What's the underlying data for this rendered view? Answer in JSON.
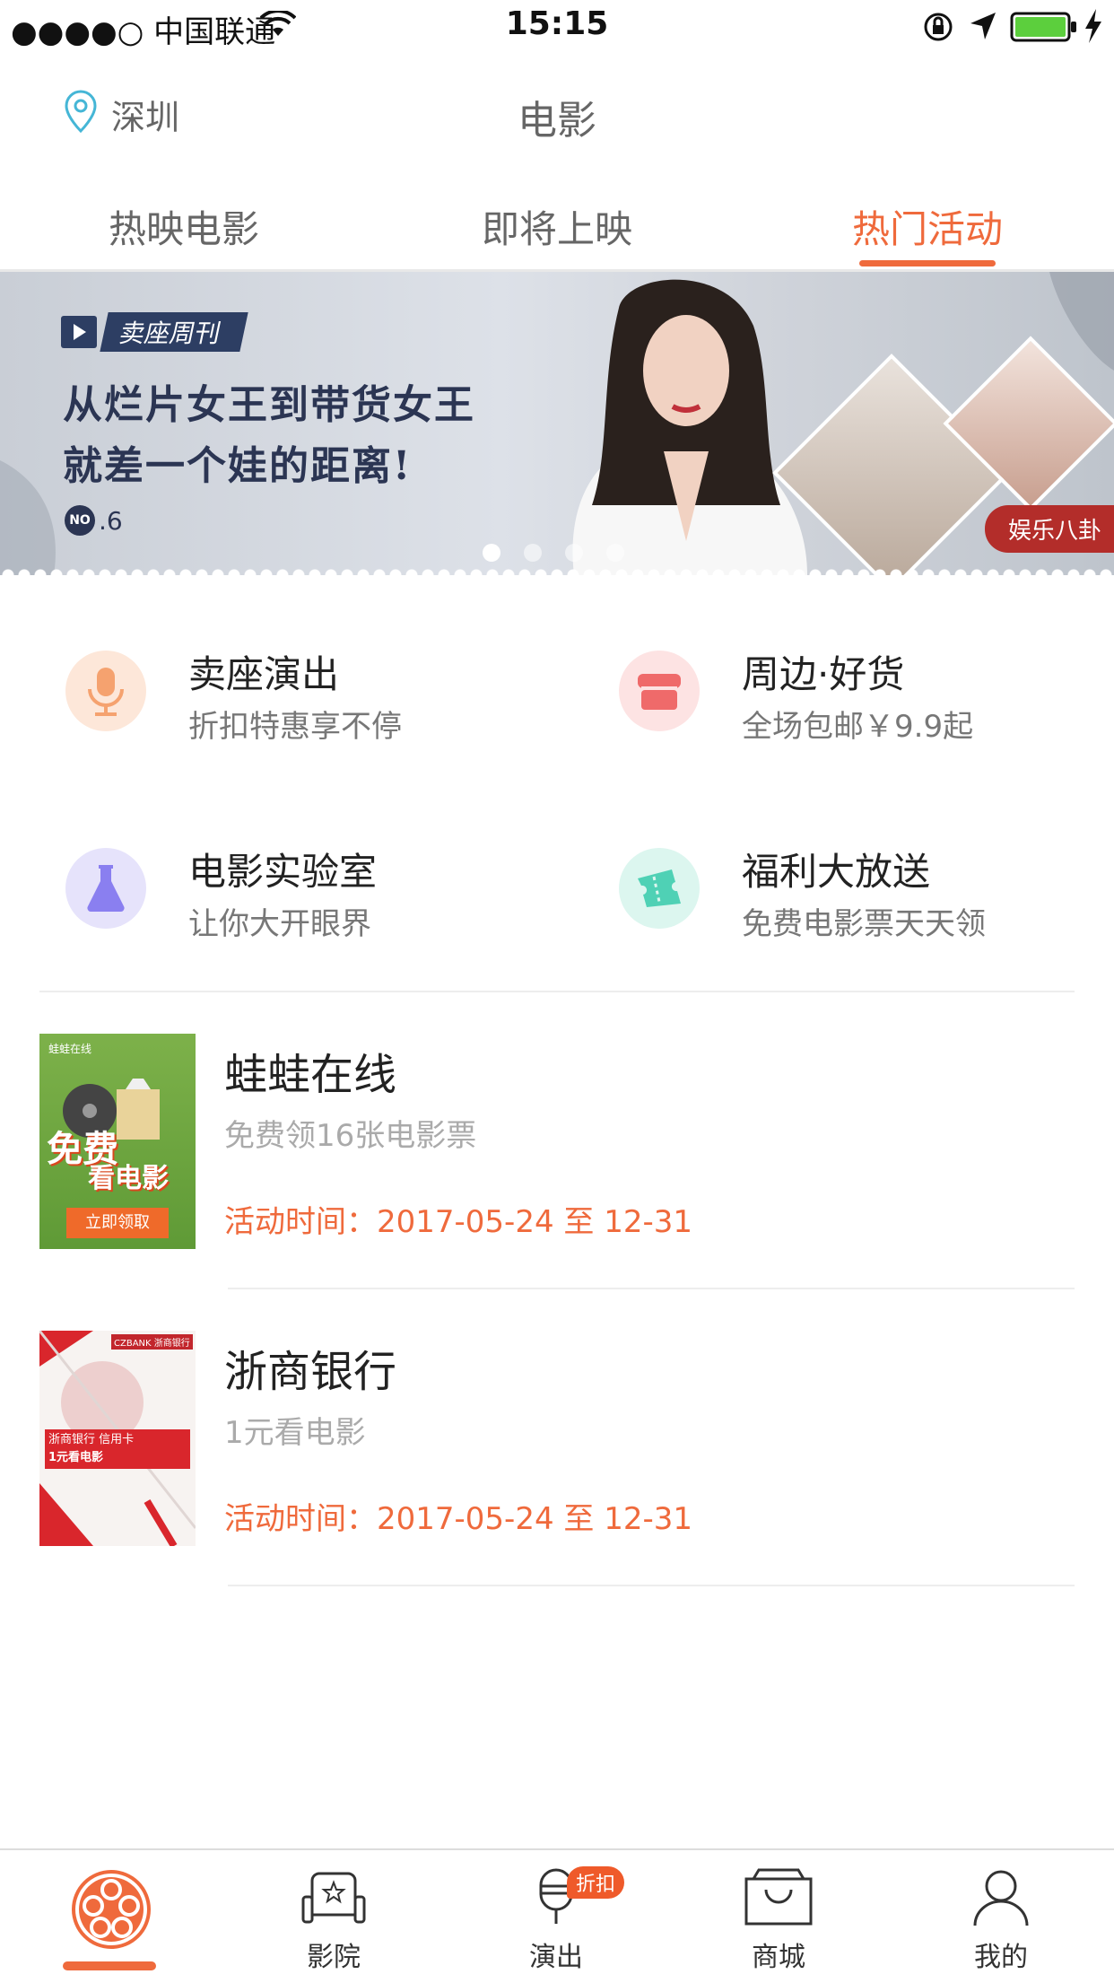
{
  "status_bar": {
    "carrier": "●●●●○ 中国联通",
    "time": "15:15",
    "icons": [
      "wifi-icon",
      "orientation-lock-icon",
      "location-arrow-icon",
      "battery-icon",
      "charging-icon"
    ]
  },
  "nav": {
    "city": "深圳",
    "title": "电影"
  },
  "tabs": [
    {
      "label": "热映电影",
      "active": false
    },
    {
      "label": "即将上映",
      "active": false
    },
    {
      "label": "热门活动",
      "active": true
    }
  ],
  "banner": {
    "tag": "卖座周刊",
    "line1": "从烂片女王到带货女王",
    "line2": "就差一个娃的距离!",
    "issue_badge": "NO",
    "issue_number": ".6",
    "category_badge": "娱乐八卦",
    "page_count": 4,
    "current_page": 1
  },
  "grid": [
    {
      "title": "卖座演出",
      "subtitle": "折扣特惠享不停",
      "icon": "microphone-icon",
      "color": "#f5a26f",
      "bg": "#fde7d9"
    },
    {
      "title": "周边·好货",
      "subtitle": "全场包邮￥9.9起",
      "icon": "shop-icon",
      "color": "#ef6a6a",
      "bg": "#fde3e3"
    },
    {
      "title": "电影实验室",
      "subtitle": "让你大开眼界",
      "icon": "flask-icon",
      "color": "#8a7ff0",
      "bg": "#e6e3fb"
    },
    {
      "title": "福利大放送",
      "subtitle": "免费电影票天天领",
      "icon": "ticket-icon",
      "color": "#4fd1b5",
      "bg": "#dcf6ef"
    }
  ],
  "activities": [
    {
      "title": "蛙蛙在线",
      "desc": "免费领16张电影票",
      "time": "活动时间：2017-05-24 至 12-31",
      "thumb": {
        "brand": "蛙蛙在线",
        "line1": "免费",
        "line2": "看电影",
        "button": "立即领取"
      }
    },
    {
      "title": "浙商银行",
      "desc": "1元看电影",
      "time": "活动时间：2017-05-24 至 12-31",
      "thumb": {
        "brand": "CZBANK 浙商银行",
        "line1": "浙商银行 信用卡",
        "line2": "1元看电影"
      }
    }
  ],
  "tabbar": [
    {
      "label": "",
      "icon": "film-reel-icon",
      "active": true
    },
    {
      "label": "影院",
      "icon": "cinema-seat-icon",
      "active": false
    },
    {
      "label": "演出",
      "icon": "microphone-icon",
      "active": false,
      "badge": "折扣"
    },
    {
      "label": "商城",
      "icon": "shopping-bag-icon",
      "active": false
    },
    {
      "label": "我的",
      "icon": "user-icon",
      "active": false
    }
  ]
}
